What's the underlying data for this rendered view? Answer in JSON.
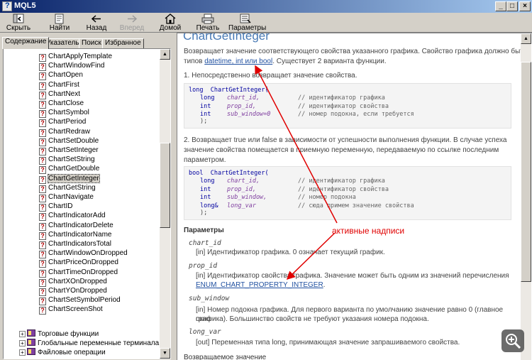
{
  "window": {
    "title": "MQL5"
  },
  "toolbar": {
    "hide": "Скрыть",
    "find": "Найти",
    "back": "Назад",
    "forward": "Вперед",
    "home": "Домой",
    "print": "Печать",
    "options": "Параметры"
  },
  "tabs": [
    "Содержание",
    "Указатель",
    "Поиск",
    "Избранное"
  ],
  "tree": {
    "items": [
      "ChartApplyTemplate",
      "ChartWindowFind",
      "ChartOpen",
      "ChartFirst",
      "ChartNext",
      "ChartClose",
      "ChartSymbol",
      "ChartPeriod",
      "ChartRedraw",
      "ChartSetDouble",
      "ChartSetInteger",
      "ChartSetString",
      "ChartGetDouble",
      "ChartGetInteger",
      "ChartGetString",
      "ChartNavigate",
      "ChartID",
      "ChartIndicatorAdd",
      "ChartIndicatorDelete",
      "ChartIndicatorName",
      "ChartIndicatorsTotal",
      "ChartWindowOnDropped",
      "ChartPriceOnDropped",
      "ChartTimeOnDropped",
      "ChartXOnDropped",
      "ChartYOnDropped",
      "ChartSetSymbolPeriod",
      "ChartScreenShot"
    ],
    "selected": "ChartGetInteger",
    "books": [
      "Торговые функции",
      "Глобальные переменные терминала",
      "Файловые операции"
    ]
  },
  "content": {
    "heading": "ChartGetInteger",
    "intro1": "Возвращает значение соответствующего свойства указанного графика. Свойство графика должно быть",
    "intro2_pre": "типов ",
    "intro2_link": "datetime, int или bool",
    "intro2_post": ". Существует 2 варианта функции.",
    "variant1": "1. Непосредственно возвращает значение свойства.",
    "code1": {
      "ret": "long",
      "name": "ChartGetInteger(",
      "params": [
        {
          "type": "long",
          "name": "chart_id,",
          "comment": "// идентификатор графика"
        },
        {
          "type": "int",
          "name": "prop_id,",
          "comment": "// идентификатор свойства"
        },
        {
          "type": "int",
          "name": "sub_window=0",
          "comment": "// номер подокна, если требуется"
        }
      ],
      "close": ");"
    },
    "variant2": [
      "2. Возвращает true или false в зависимости от успешности выполнения функции.  В случае успеха",
      "значение свойства помещается в приемную переменную, передаваемую по ссылке последним",
      "параметром."
    ],
    "code2": {
      "ret": "bool",
      "name": "ChartGetInteger(",
      "params": [
        {
          "type": "long",
          "name": "chart_id,",
          "comment": "// идентификатор графика"
        },
        {
          "type": "int",
          "name": "prop_id,",
          "comment": "// идентификатор свойства"
        },
        {
          "type": "int",
          "name": "sub_window,",
          "comment": "// номер подокна"
        },
        {
          "type": "long&",
          "name": "long_var",
          "comment": "// сюда примем значение свойства"
        }
      ],
      "close": ");"
    },
    "params_title": "Параметры",
    "params": [
      {
        "name": "chart_id",
        "desc": [
          "[in]  Идентификатор графика. 0 означает текущий график."
        ]
      },
      {
        "name": "prop_id",
        "desc": [
          "[in]  Идентификатор свойства графика. Значение может быть одним из значений перечисления"
        ],
        "link": "ENUM_CHART_PROPERTY_INTEGER",
        "link_after": "."
      },
      {
        "name": "sub_window",
        "desc": [
          "[in]  Номер подокна графика. Для первого варианта по умолчанию значение равно 0 (главное окно",
          "графика). Большинство свойств не требуют указания номера подокна."
        ]
      },
      {
        "name": "long_var",
        "desc": [
          "[out]  Переменная типа long, принимающая  значение запрашиваемого свойства."
        ]
      }
    ],
    "bottom_cut": "Возвращаемое значение"
  },
  "annotation": {
    "text": "активные надписи",
    "color": "#e00000"
  }
}
